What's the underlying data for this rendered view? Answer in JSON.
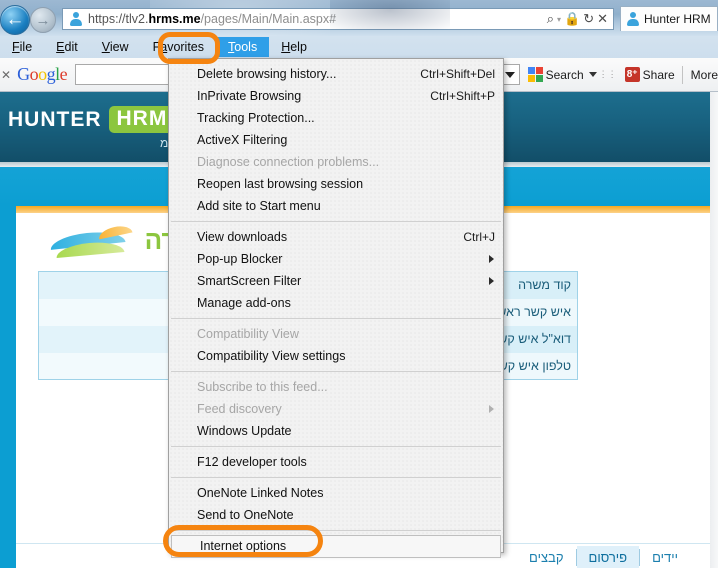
{
  "browser": {
    "back_label": "←",
    "forward_label": "→",
    "url_prefix": "https://tlv2.",
    "url_domain": "hrms.me",
    "url_path": "/pages/Main/Main.aspx#",
    "addr_icons": {
      "search": "⌕",
      "caret": "▾",
      "lock": "🔒",
      "refresh": "↻",
      "stop": "✕"
    },
    "tab_title": "Hunter HRM",
    "menubar": [
      {
        "label": "File",
        "underline": "F",
        "active": false
      },
      {
        "label": "Edit",
        "underline": "E",
        "active": false
      },
      {
        "label": "View",
        "underline": "V",
        "active": false
      },
      {
        "label": "Favorites",
        "underline": "a",
        "active": false
      },
      {
        "label": "Tools",
        "underline": "T",
        "active": true
      },
      {
        "label": "Help",
        "underline": "H",
        "active": false
      }
    ]
  },
  "google_toolbar": {
    "close_label": "✕",
    "logo": "Google",
    "search_value": "",
    "search_placeholder": "",
    "search_button": "Search",
    "share_button": "Share",
    "share_icon_glyph": "8⁺",
    "more_button": "More"
  },
  "tools_menu": {
    "items": [
      {
        "label": "Delete browsing history...",
        "accel": "Ctrl+Shift+Del",
        "disabled": false,
        "submenu": false,
        "separator_after": false,
        "boxed": false
      },
      {
        "label": "InPrivate Browsing",
        "accel": "Ctrl+Shift+P",
        "disabled": false,
        "submenu": false,
        "separator_after": false,
        "boxed": false
      },
      {
        "label": "Tracking Protection...",
        "accel": "",
        "disabled": false,
        "submenu": false,
        "separator_after": false,
        "boxed": false
      },
      {
        "label": "ActiveX Filtering",
        "accel": "",
        "disabled": false,
        "submenu": false,
        "separator_after": false,
        "boxed": false
      },
      {
        "label": "Diagnose connection problems...",
        "accel": "",
        "disabled": true,
        "submenu": false,
        "separator_after": false,
        "boxed": false
      },
      {
        "label": "Reopen last browsing session",
        "accel": "",
        "disabled": false,
        "submenu": false,
        "separator_after": false,
        "boxed": false
      },
      {
        "label": "Add site to Start menu",
        "accel": "",
        "disabled": false,
        "submenu": false,
        "separator_after": true,
        "boxed": false
      },
      {
        "label": "View downloads",
        "accel": "Ctrl+J",
        "disabled": false,
        "submenu": false,
        "separator_after": false,
        "boxed": false
      },
      {
        "label": "Pop-up Blocker",
        "accel": "",
        "disabled": false,
        "submenu": true,
        "separator_after": false,
        "boxed": false
      },
      {
        "label": "SmartScreen Filter",
        "accel": "",
        "disabled": false,
        "submenu": true,
        "separator_after": false,
        "boxed": false
      },
      {
        "label": "Manage add-ons",
        "accel": "",
        "disabled": false,
        "submenu": false,
        "separator_after": true,
        "boxed": false
      },
      {
        "label": "Compatibility View",
        "accel": "",
        "disabled": true,
        "submenu": false,
        "separator_after": false,
        "boxed": false
      },
      {
        "label": "Compatibility View settings",
        "accel": "",
        "disabled": false,
        "submenu": false,
        "separator_after": true,
        "boxed": false
      },
      {
        "label": "Subscribe to this feed...",
        "accel": "",
        "disabled": true,
        "submenu": false,
        "separator_after": false,
        "boxed": false
      },
      {
        "label": "Feed discovery",
        "accel": "",
        "disabled": true,
        "submenu": true,
        "separator_after": false,
        "boxed": false
      },
      {
        "label": "Windows Update",
        "accel": "",
        "disabled": false,
        "submenu": false,
        "separator_after": true,
        "boxed": false
      },
      {
        "label": "F12 developer tools",
        "accel": "",
        "disabled": false,
        "submenu": false,
        "separator_after": true,
        "boxed": false
      },
      {
        "label": "OneNote Linked Notes",
        "accel": "",
        "disabled": false,
        "submenu": false,
        "separator_after": false,
        "boxed": false
      },
      {
        "label": "Send to OneNote",
        "accel": "",
        "disabled": false,
        "submenu": false,
        "separator_after": true,
        "boxed": false
      },
      {
        "label": "Internet options",
        "accel": "",
        "disabled": false,
        "submenu": false,
        "separator_after": false,
        "boxed": true
      }
    ]
  },
  "app": {
    "brand_primary": "HUNTER",
    "brand_secondary": "HRMS",
    "header_sub": "מ",
    "logo_word": "משרה",
    "form_rows": [
      {
        "label": "קוד משרה",
        "value": ""
      },
      {
        "label": "איש קשר ראשי",
        "value": ""
      },
      {
        "label": "דוא\"ל איש קשר",
        "value": ""
      },
      {
        "label": "טלפון איש קשר",
        "value": ""
      }
    ],
    "tabs": [
      {
        "label": "יידים",
        "selected": false
      },
      {
        "label": "פירסום",
        "selected": true
      },
      {
        "label": "קבצים",
        "selected": false
      }
    ]
  },
  "annotations": {
    "color": "#f58410",
    "items": [
      {
        "name": "tools-menu-highlight",
        "target": "Tools"
      },
      {
        "name": "internet-options-highlight",
        "target": "Internet options"
      }
    ]
  }
}
